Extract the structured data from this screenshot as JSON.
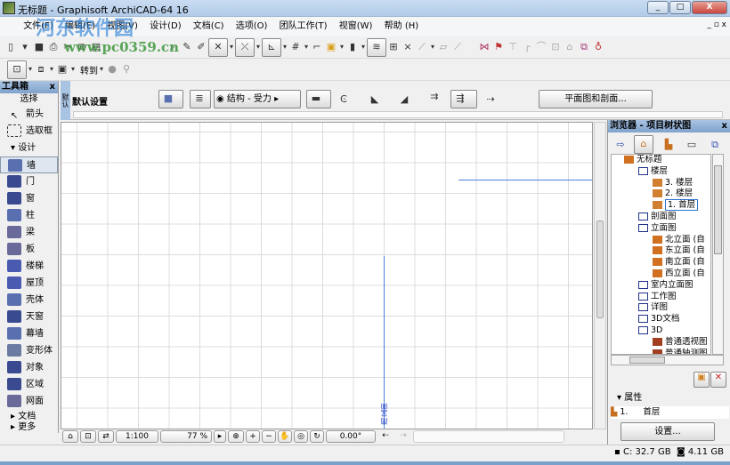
{
  "window": {
    "title": "无标题 - Graphisoft ArchiCAD-64 16",
    "min": "_",
    "max": "□",
    "close": "X"
  },
  "watermark": {
    "text": "河东软件园",
    "url": "www.pc0359.cn"
  },
  "menu": [
    "文件(F)",
    "编辑(E)",
    "视图(V)",
    "设计(D)",
    "文档(C)",
    "选项(O)",
    "团队工作(T)",
    "视窗(W)",
    "帮助 (H)"
  ],
  "toolbar2": {
    "goto": "转到"
  },
  "infobox": {
    "title": "默认设置",
    "layer": "结构 - 受力",
    "tab": "平面图和剖面...",
    "side_tab": "默认"
  },
  "toolbox": {
    "title": "工具箱",
    "close": "x",
    "select_header": "选择",
    "select_tools": [
      "箭头",
      "选取框"
    ],
    "design_header": "设计",
    "design_tools": [
      "墙",
      "门",
      "窗",
      "柱",
      "梁",
      "板",
      "楼梯",
      "屋顶",
      "壳体",
      "天窗",
      "幕墙",
      "变形体",
      "对象",
      "区域",
      "网面"
    ],
    "more": [
      "文档",
      "更多"
    ]
  },
  "canvas": {
    "marker_label": "南立面"
  },
  "status": {
    "scale": "1:100",
    "zoom": "77 %",
    "angle": "0.00°"
  },
  "browser": {
    "title": "浏览器 - 项目树状图",
    "close": "x",
    "tree": [
      {
        "label": "无标题",
        "level": 0,
        "icon": "project-icon"
      },
      {
        "label": "楼层",
        "level": 1,
        "icon": "stories-icon"
      },
      {
        "label": "3.  楼层",
        "level": 2,
        "icon": "story-icon"
      },
      {
        "label": "2.  楼层",
        "level": 2,
        "icon": "story-icon"
      },
      {
        "label": "1.  首层",
        "level": 2,
        "icon": "story-icon",
        "selected": true
      },
      {
        "label": "剖面图",
        "level": 1,
        "icon": "section-icon"
      },
      {
        "label": "立面图",
        "level": 1,
        "icon": "elevation-icon"
      },
      {
        "label": "北立面 (自",
        "level": 2,
        "icon": "house-icon"
      },
      {
        "label": "东立面 (自",
        "level": 2,
        "icon": "house-icon"
      },
      {
        "label": "南立面 (自",
        "level": 2,
        "icon": "house-icon"
      },
      {
        "label": "西立面 (自",
        "level": 2,
        "icon": "house-icon"
      },
      {
        "label": "室内立面图",
        "level": 1,
        "icon": "interior-icon"
      },
      {
        "label": "工作图",
        "level": 1,
        "icon": "worksheet-icon"
      },
      {
        "label": "详图",
        "level": 1,
        "icon": "detail-icon"
      },
      {
        "label": "3D文档",
        "level": 1,
        "icon": "3d-doc-icon"
      },
      {
        "label": "3D",
        "level": 1,
        "icon": "3d-icon"
      },
      {
        "label": "普通透视图",
        "level": 2,
        "icon": "camera-icon"
      },
      {
        "label": "普通轴测图",
        "level": 2,
        "icon": "axon-icon"
      }
    ],
    "properties_label": "属性",
    "prop_number": "1.",
    "prop_name": "首层",
    "settings": "设置..."
  },
  "memory": {
    "disk": "C: 32.7 GB",
    "ram": "4.11 GB"
  },
  "colors": {
    "title_bar": "#b3cbe8",
    "palette_header": "#7fa2cc",
    "grid": "#dcdcdc",
    "blue_line": "#4a7fe0",
    "close_red": "#c9463d"
  }
}
